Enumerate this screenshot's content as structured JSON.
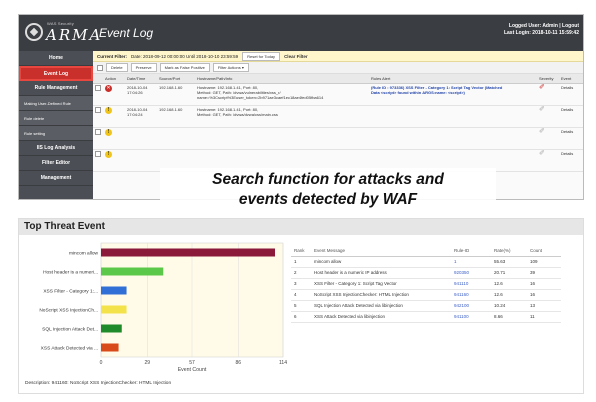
{
  "logo": {
    "small_text": "WAS Security",
    "brand": "ARMA"
  },
  "header": {
    "title": "Event Log",
    "logged_user": "Logged User: Admin | Logout",
    "last_login": "Last Login: 2018-10-11 15:59:42"
  },
  "sidebar": {
    "items": [
      {
        "label": "Home"
      },
      {
        "label": "Event Log"
      },
      {
        "label": "Rule Management"
      },
      {
        "label": "Making User-Defined Rule"
      },
      {
        "label": "Rule delete"
      },
      {
        "label": "Rule setting"
      },
      {
        "label": "IIS Log Analysis"
      },
      {
        "label": "Filter Editor"
      },
      {
        "label": "Management"
      }
    ]
  },
  "filter": {
    "label": "Current Filter:",
    "text": "Date: 2018-09-12 00:00:00 Until 2018-10-10 23:59:59",
    "reset": "Reset for Today",
    "clear": "Clear Filter"
  },
  "toolbar": {
    "delete": "Delete",
    "preserve": "Preserve",
    "false_positive": "Mark as False Positive",
    "filter_actions": "Filter Actions ▾"
  },
  "table": {
    "headers": [
      "Action",
      "Date/Time",
      "Source/Port",
      "Hostname/Path/Info",
      "Rules Alert",
      "Severity",
      "Event"
    ],
    "rows": [
      {
        "date": "2018-10-04",
        "time": "17:04:26",
        "source": "192.168.1.60",
        "info1": "Hostname: 192.168.1.41, Port: 80,",
        "info2": "Method: GET, Path: /dvwa/vulnerabilities/xss_r/",
        "info3": "name=%3Cscript%3Euser_token=2b971ae3caef1ec18ae4fed05fba614",
        "alert": "(Rule ID : 973336) XSS Filter - Category 1: Script Tag Vector (Matched",
        "alert2": "Data <script> found within ARGS:name: <script>)",
        "event": "Details"
      },
      {
        "date": "2018-10-04",
        "time": "17:04:24",
        "source": "192.168.1.60",
        "info1": "Hostname: 192.168.1.41, Port: 80,",
        "info2": "Method: GET, Path: /dvwa/dvwa/css/main.css",
        "info3": "",
        "alert": "",
        "alert2": "",
        "event": "Details"
      },
      {
        "date": "",
        "time": "",
        "source": "",
        "info1": "",
        "info2": "",
        "info3": "",
        "alert": "",
        "alert2": "",
        "event": "Details"
      },
      {
        "date": "",
        "time": "",
        "source": "",
        "info1": "",
        "info2": "",
        "info3": "",
        "alert": "",
        "alert2": "",
        "event": "Details"
      }
    ]
  },
  "overlay": {
    "line1": "Search function for attacks and",
    "line2": "events detected by WAF"
  },
  "threat": {
    "title": "Top Threat Event",
    "description": "Description: 941160: NoScript XSS InjectionChecker: HTML Injection",
    "rank_headers": [
      "Rank",
      "Event Message",
      "Rule-ID",
      "Rate(%)",
      "Count"
    ],
    "rank_rows": [
      [
        "1",
        "mincom allow",
        "1",
        "55.63",
        "109"
      ],
      [
        "2",
        "Host header is a numeric IP address",
        "920350",
        "20.71",
        "39"
      ],
      [
        "3",
        "XSS Filter - Category 1: Script Tag Vector",
        "941110",
        "12.6",
        "16"
      ],
      [
        "4",
        "NoScript XSS InjectionChecker: HTML Injection",
        "941160",
        "12.6",
        "16"
      ],
      [
        "5",
        "SQL Injection Attack Detected via libinjection",
        "942100",
        "10.24",
        "13"
      ],
      [
        "6",
        "XSS Attack Detected via libinjection",
        "941100",
        "8.66",
        "11"
      ]
    ]
  },
  "chart_data": {
    "type": "bar",
    "orientation": "horizontal",
    "categories": [
      "mincom allow",
      "Host header is a numeri...",
      "XSS Filter - Category 1:...",
      "NoScript XSS InjectionCh...",
      "SQL Injection Attack Det...",
      "XSS Attack Detected via ..."
    ],
    "values": [
      109,
      39,
      16,
      16,
      13,
      11
    ],
    "colors": [
      "#8b1a3a",
      "#5cc84a",
      "#2f6fd6",
      "#f4e24a",
      "#1f8a2a",
      "#d94a1a"
    ],
    "xlabel": "Event Count",
    "ylabel": "",
    "title": "",
    "xticks": [
      0,
      29,
      57,
      86,
      114
    ],
    "xlim": [
      0,
      114
    ],
    "grid": true
  }
}
